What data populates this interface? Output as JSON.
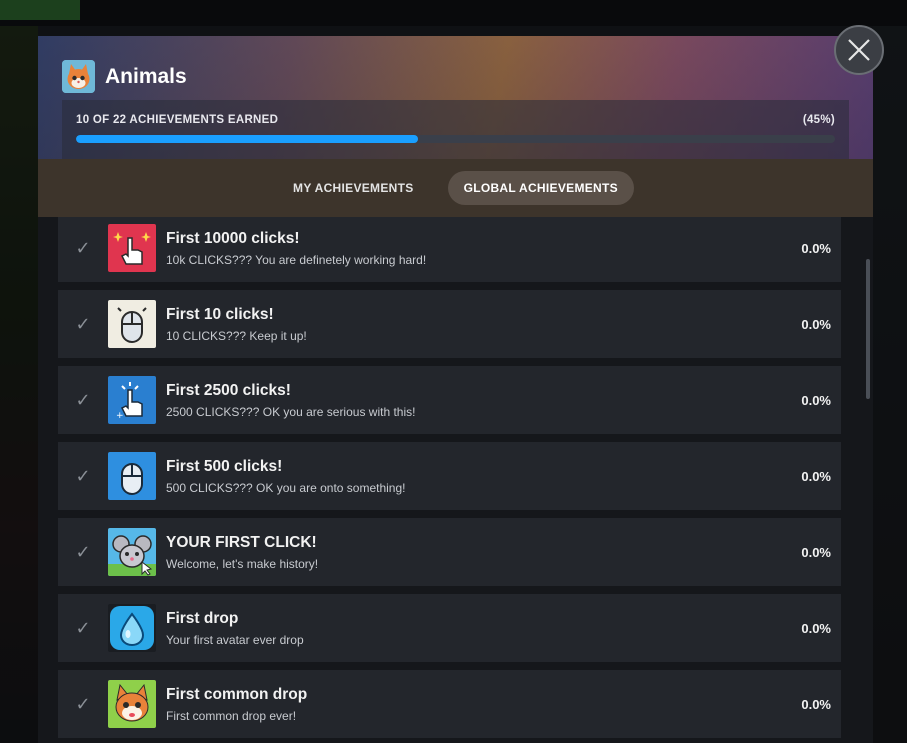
{
  "game": {
    "title": "Animals",
    "icon": "cat-avatar-icon"
  },
  "progress": {
    "earned_label": "10 OF 22 ACHIEVEMENTS EARNED",
    "percent_label": "(45%)",
    "fraction": 0.45,
    "fill_color": "#1a9fff"
  },
  "tabs": [
    {
      "label": "MY ACHIEVEMENTS",
      "active": false
    },
    {
      "label": "GLOBAL ACHIEVEMENTS",
      "active": true
    }
  ],
  "achievements": [
    {
      "title": "First 10000 clicks!",
      "desc": "10k CLICKS??? You are definetely working hard!",
      "pct": "0.0%",
      "icon": "hand-click-sparkle-icon",
      "icon_bg": "#e0354f"
    },
    {
      "title": "First 10 clicks!",
      "desc": "10 CLICKS??? Keep it up!",
      "pct": "0.0%",
      "icon": "mouse-icon",
      "icon_bg": "#f0ede2"
    },
    {
      "title": "First 2500 clicks!",
      "desc": "2500 CLICKS??? OK you are serious with this!",
      "pct": "0.0%",
      "icon": "hand-click-icon",
      "icon_bg": "#2a7fd0"
    },
    {
      "title": "First 500 clicks!",
      "desc": "500 CLICKS??? OK you are onto something!",
      "pct": "0.0%",
      "icon": "mouse-icon",
      "icon_bg": "#2e8fe0"
    },
    {
      "title": "YOUR FIRST CLICK!",
      "desc": "Welcome, let's make history!",
      "pct": "0.0%",
      "icon": "mouse-animal-icon",
      "icon_bg": "#56b8e8"
    },
    {
      "title": "First drop",
      "desc": "Your first avatar ever drop",
      "pct": "0.0%",
      "icon": "water-drop-icon",
      "icon_bg": "#1a1d22"
    },
    {
      "title": "First common drop",
      "desc": "First common drop ever!",
      "pct": "0.0%",
      "icon": "cat-avatar-icon",
      "icon_bg": "#8fd04a"
    }
  ]
}
